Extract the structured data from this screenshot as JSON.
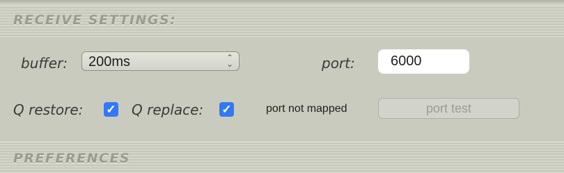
{
  "receive_settings": {
    "title": "RECEIVE SETTINGS:",
    "buffer": {
      "label": "buffer:",
      "selected": "200ms"
    },
    "port": {
      "label": "port:",
      "value": "6000"
    },
    "q_restore": {
      "label": "Q restore:",
      "checked": true
    },
    "q_replace": {
      "label": "Q replace:",
      "checked": true
    },
    "port_status": "port not mapped",
    "port_test_label": "port test"
  },
  "preferences": {
    "title": "PREFERENCES"
  },
  "icons": {
    "checkmark": "✓",
    "select_chevrons": "⌃⌄"
  },
  "colors": {
    "checkbox_accent": "#3478f6",
    "panel_bg": "#c9cbbe"
  }
}
